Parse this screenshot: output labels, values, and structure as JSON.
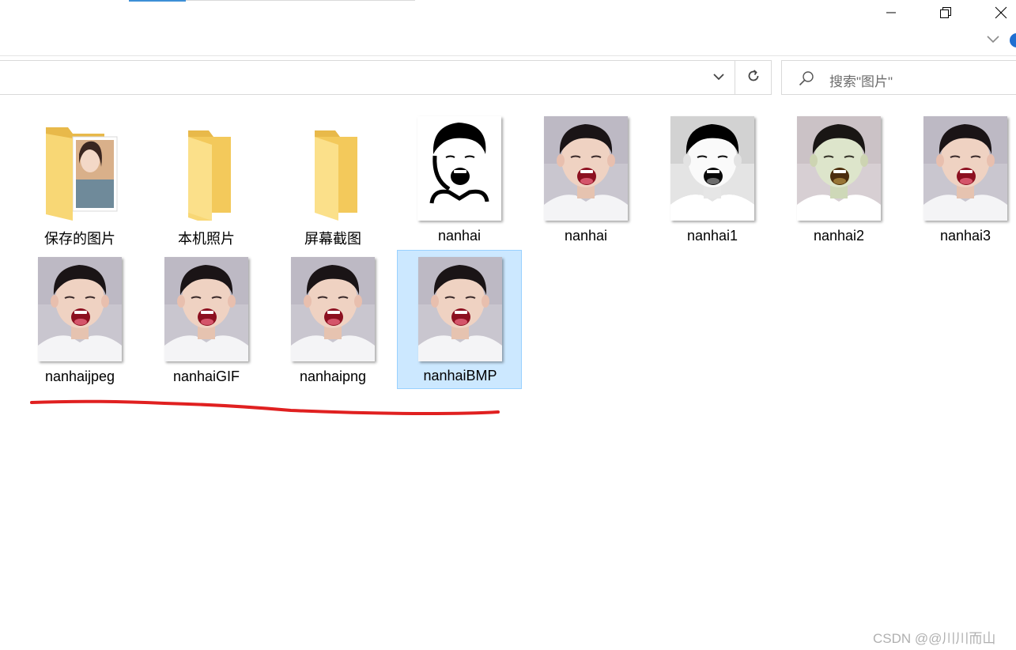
{
  "window": {
    "minimize_icon": "minimize-icon",
    "restore_icon": "restore-icon",
    "close_icon": "close-icon",
    "expand_icon": "chevron-down-icon"
  },
  "address": {
    "dropdown_icon": "chevron-down-icon",
    "refresh_icon": "refresh-icon"
  },
  "search": {
    "placeholder": "搜索\"图片\"",
    "icon": "search-icon"
  },
  "items": [
    {
      "label": "保存的图片",
      "kind": "folder-with-photo"
    },
    {
      "label": "本机照片",
      "kind": "folder"
    },
    {
      "label": "屏幕截图",
      "kind": "folder"
    },
    {
      "label": "nanhai",
      "kind": "image-bw"
    },
    {
      "label": "nanhai",
      "kind": "image"
    },
    {
      "label": "nanhai1",
      "kind": "image-gray"
    },
    {
      "label": "nanhai2",
      "kind": "image-tint"
    },
    {
      "label": "nanhai3",
      "kind": "image"
    },
    {
      "label": "nanhaijpeg",
      "kind": "image"
    },
    {
      "label": "nanhaiGIF",
      "kind": "image"
    },
    {
      "label": "nanhaipng",
      "kind": "image"
    },
    {
      "label": "nanhaiBMP",
      "kind": "image",
      "selected": true
    }
  ],
  "annotation": {
    "color": "#e02020"
  },
  "watermark": "CSDN @@川川而山",
  "colors": {
    "selection_bg": "#cce8ff",
    "selection_border": "#99d1ff",
    "folder": "#f8d775"
  }
}
